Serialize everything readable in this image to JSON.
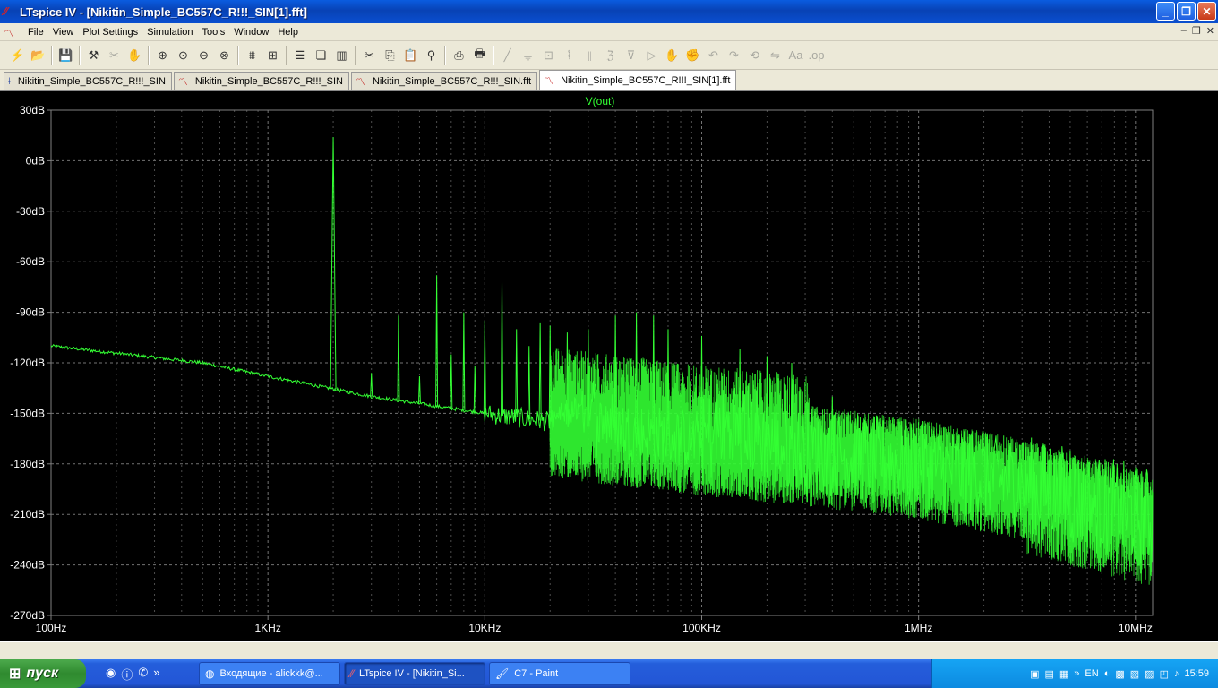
{
  "window": {
    "title": "LTspice IV - [Nikitin_Simple_BC557C_R!!!_SIN[1].fft]",
    "buttons": {
      "minimize": "_",
      "maximize": "❐",
      "close": "✕"
    }
  },
  "menu": [
    "File",
    "View",
    "Plot Settings",
    "Simulation",
    "Tools",
    "Window",
    "Help"
  ],
  "toolbar": {
    "icons": [
      "run-icon",
      "open-icon",
      "save-icon",
      "control-panel-icon",
      "scissors-dim-icon",
      "hand-dim-icon",
      "zoom-in-icon",
      "zoom-extent-icon",
      "zoom-out-icon",
      "zoom-cancel-icon",
      "autorange-icon",
      "grid-icon",
      "tile-horizontal-icon",
      "cascade-icon",
      "tile-vertical-icon",
      "cut-icon",
      "copy-icon",
      "paste-icon",
      "find-icon",
      "print-preview-icon",
      "print-icon"
    ]
  },
  "tabs": [
    {
      "label": "Nikitin_Simple_BC557C_R!!!_SIN",
      "icon": "schematic-icon",
      "active": false
    },
    {
      "label": "Nikitin_Simple_BC557C_R!!!_SIN",
      "icon": "waveform-icon",
      "active": false
    },
    {
      "label": "Nikitin_Simple_BC557C_R!!!_SIN.fft",
      "icon": "waveform-icon",
      "active": false
    },
    {
      "label": "Nikitin_Simple_BC557C_R!!!_SIN[1].fft",
      "icon": "waveform-icon",
      "active": true
    }
  ],
  "colors": {
    "plot_bg": "#000000",
    "trace": "#33ff33",
    "grid": "#808080",
    "axis_text": "#ffffff"
  },
  "chart_data": {
    "type": "line",
    "title": "V(out)",
    "xscale": "log",
    "xlim": [
      100,
      12000000
    ],
    "ylim": [
      -270,
      30
    ],
    "grid": true,
    "x_ticks": [
      "100Hz",
      "1KHz",
      "10KHz",
      "100KHz",
      "1MHz",
      "10MHz"
    ],
    "x_tick_values": [
      100,
      1000,
      10000,
      100000,
      1000000,
      10000000
    ],
    "y_ticks": [
      "30dB",
      "0dB",
      "-30dB",
      "-60dB",
      "-90dB",
      "-120dB",
      "-150dB",
      "-180dB",
      "-210dB",
      "-240dB",
      "-270dB"
    ],
    "y_tick_values": [
      30,
      0,
      -30,
      -60,
      -90,
      -120,
      -150,
      -180,
      -210,
      -240,
      -270
    ],
    "series": [
      {
        "name": "V(out)",
        "noise_floor": [
          [
            100,
            -110
          ],
          [
            500,
            -120
          ],
          [
            1000,
            -128
          ],
          [
            3000,
            -140
          ],
          [
            10000,
            -150
          ],
          [
            30000,
            -158
          ],
          [
            100000,
            -166
          ],
          [
            300000,
            -172
          ],
          [
            1000000,
            -180
          ],
          [
            3000000,
            -192
          ],
          [
            10000000,
            -210
          ],
          [
            12000000,
            -212
          ]
        ],
        "peaks": [
          [
            2000,
            14
          ],
          [
            3000,
            -126
          ],
          [
            4000,
            -92
          ],
          [
            5000,
            -128
          ],
          [
            6000,
            -68
          ],
          [
            7000,
            -115
          ],
          [
            8000,
            -90
          ],
          [
            9000,
            -122
          ],
          [
            10000,
            -95
          ],
          [
            12000,
            -72
          ],
          [
            14000,
            -100
          ],
          [
            16000,
            -110
          ],
          [
            18000,
            -96
          ],
          [
            20000,
            -98
          ],
          [
            24000,
            -102
          ],
          [
            30000,
            -100
          ],
          [
            40000,
            -92
          ],
          [
            50000,
            -90
          ],
          [
            60000,
            -92
          ],
          [
            70000,
            -100
          ],
          [
            100000,
            -104
          ],
          [
            150000,
            -112
          ],
          [
            200000,
            -116
          ],
          [
            260000,
            -120
          ],
          [
            400000,
            -140
          ],
          [
            5000000,
            -172
          ],
          [
            10000000,
            -198
          ]
        ]
      }
    ]
  },
  "taskbar": {
    "start_label": "пуск",
    "tasks": [
      {
        "label": "Входящие - alickkk@...",
        "icon": "firefox-icon",
        "active": false
      },
      {
        "label": "LTspice IV - [Nikitin_Si...",
        "icon": "ltspice-icon",
        "active": true
      },
      {
        "label": "C7 - Paint",
        "icon": "paint-icon",
        "active": false
      }
    ],
    "lang": "EN",
    "clock": "15:59"
  }
}
